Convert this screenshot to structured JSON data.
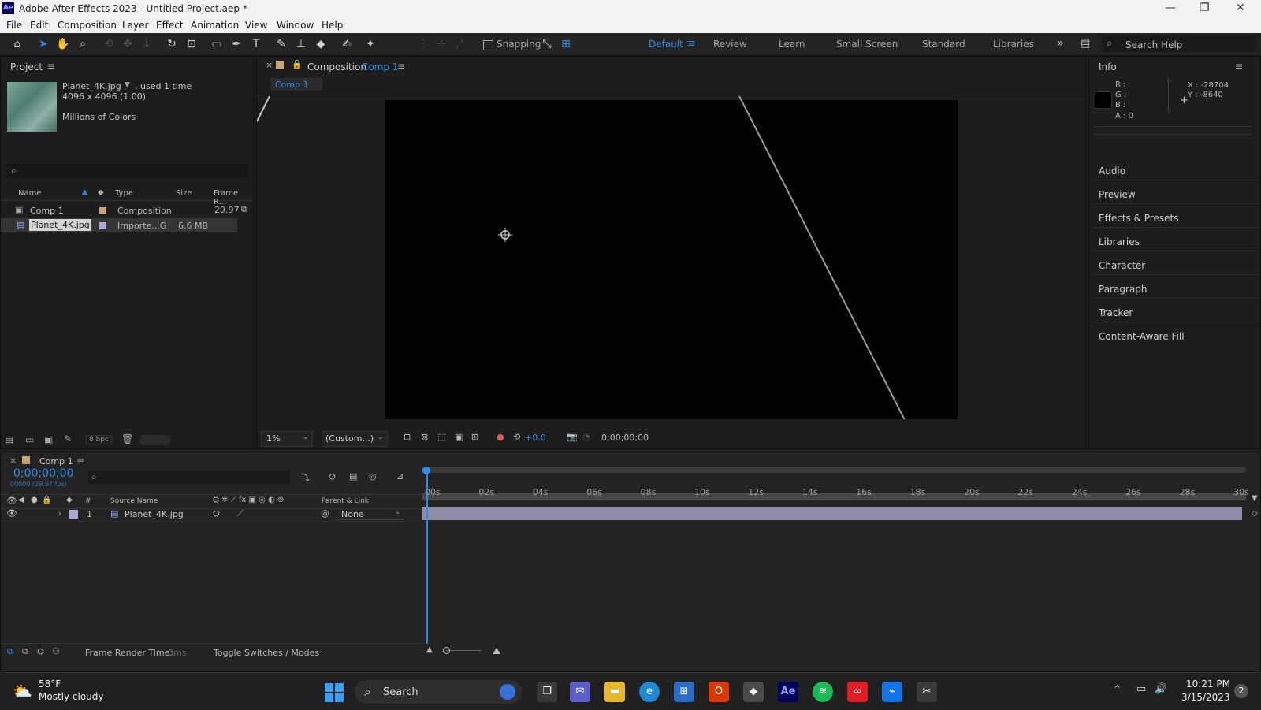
{
  "window": {
    "title": "Adobe After Effects 2023 - Untitled Project.aep *",
    "app_icon": "Ae"
  },
  "menu": [
    "File",
    "Edit",
    "Composition",
    "Layer",
    "Effect",
    "Animation",
    "View",
    "Window",
    "Help"
  ],
  "toolbar": {
    "snapping_label": "Snapping",
    "workspaces": [
      "Default",
      "Review",
      "Learn",
      "Small Screen",
      "Standard",
      "Libraries"
    ],
    "active_workspace": "Default",
    "search_placeholder": "Search Help"
  },
  "project": {
    "panel_title": "Project",
    "asset_name": "Planet_4K.jpg",
    "asset_used": ", used 1 time",
    "asset_dims": "4096 x 4096 (1.00)",
    "asset_colors": "Millions of Colors",
    "search_placeholder": "",
    "columns": [
      "Name",
      "Type",
      "Size",
      "Frame R..."
    ],
    "items": [
      {
        "name": "Comp 1",
        "type": "Composition",
        "size": "",
        "frame_rate": "29.97",
        "color": "#c7a37a"
      },
      {
        "name": "Planet_4K.jpg",
        "type": "Importe...G",
        "size": "6.6 MB",
        "frame_rate": "",
        "color": "#a9a6d8"
      }
    ],
    "bpc": "8 bpc"
  },
  "composition": {
    "panel_label": "Composition",
    "comp_name": "Comp 1",
    "tab_label": "Comp 1",
    "zoom": "1%",
    "resolution": "(Custom...)",
    "exposure": "+0.0",
    "timecode": "0;00;00;00"
  },
  "info": {
    "panel_title": "Info",
    "r": "R :",
    "g": "G :",
    "b": "B :",
    "a": "A :  0",
    "x": "X : -28704",
    "y": "Y : -8640",
    "sections": [
      "Audio",
      "Preview",
      "Effects & Presets",
      "Libraries",
      "Character",
      "Paragraph",
      "Tracker",
      "Content-Aware Fill"
    ]
  },
  "timeline": {
    "tab_label": "Comp 1",
    "timecode": "0;00;00;00",
    "frame_info": "00000 (29.97 fps)",
    "ruler": [
      "00s",
      "02s",
      "04s",
      "06s",
      "08s",
      "10s",
      "12s",
      "14s",
      "16s",
      "18s",
      "20s",
      "22s",
      "24s",
      "26s",
      "28s",
      "30s"
    ],
    "col_source": "Source Name",
    "col_parent": "Parent & Link",
    "col_num": "#",
    "layers": [
      {
        "index": "1",
        "name": "Planet_4K.jpg",
        "parent": "None",
        "color": "#a9a6d8"
      }
    ],
    "frame_render_label": "Frame Render Time:",
    "frame_render_value": "0ms",
    "toggle_label": "Toggle Switches / Modes"
  },
  "taskbar": {
    "weather_temp": "58°F",
    "weather_desc": "Mostly cloudy",
    "search_label": "Search",
    "time": "10:21 PM",
    "date": "3/15/2023",
    "notification_count": "2"
  }
}
